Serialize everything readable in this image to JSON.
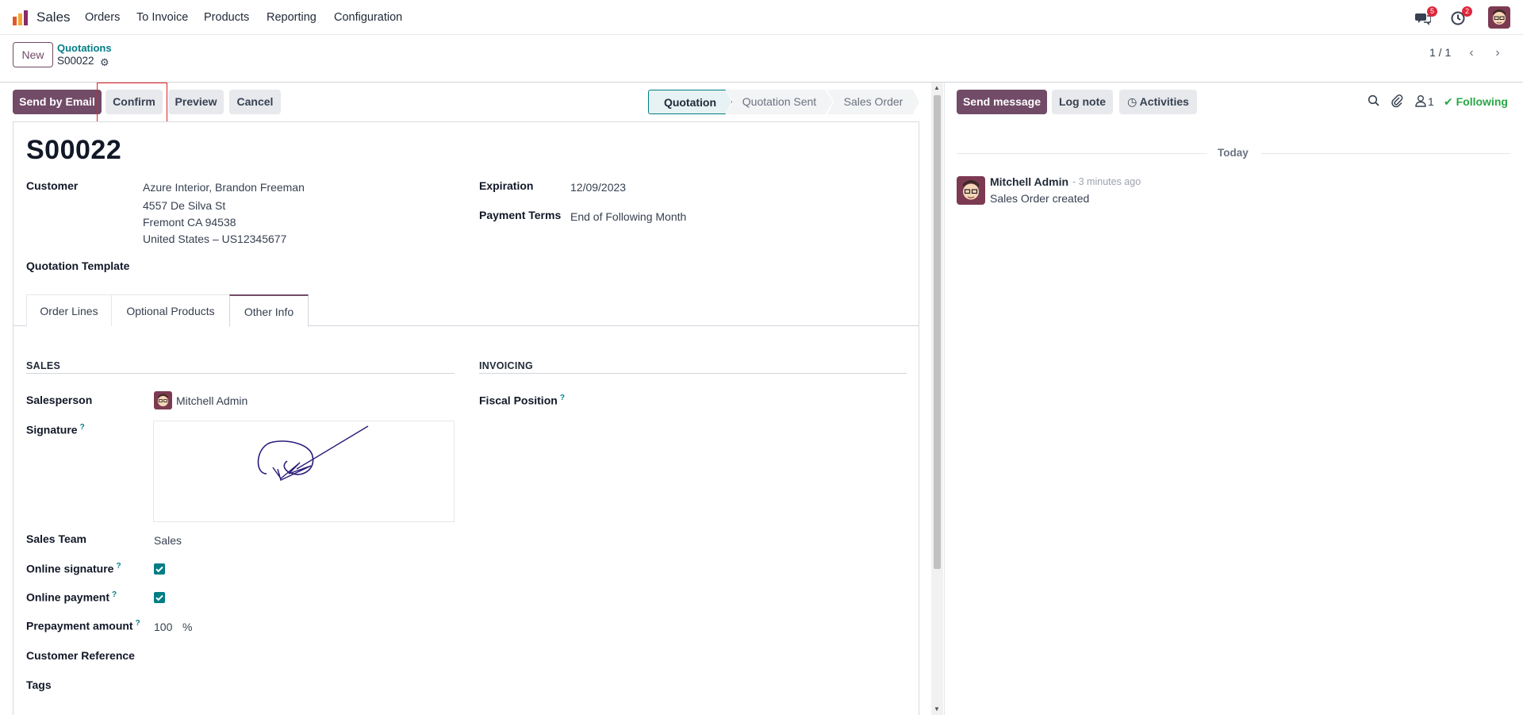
{
  "navbar": {
    "app_name": "Sales",
    "menu": [
      "Orders",
      "To Invoice",
      "Products",
      "Reporting",
      "Configuration"
    ],
    "messages_badge": "5",
    "activities_badge": "2"
  },
  "control_panel": {
    "new_label": "New",
    "breadcrumb_parent": "Quotations",
    "breadcrumb_current": "S00022",
    "pager": "1 / 1"
  },
  "actions": {
    "send_email": "Send by Email",
    "confirm": "Confirm",
    "preview": "Preview",
    "cancel": "Cancel"
  },
  "statusbar": {
    "states": [
      "Quotation",
      "Quotation Sent",
      "Sales Order"
    ],
    "active": "Quotation"
  },
  "form": {
    "title": "S00022",
    "customer_label": "Customer",
    "customer_lines": [
      "Azure Interior, Brandon Freeman",
      "4557 De Silva St",
      "Fremont CA 94538",
      "United States – US12345677"
    ],
    "expiration_label": "Expiration",
    "expiration_value": "12/09/2023",
    "payment_terms_label": "Payment Terms",
    "payment_terms_value": "End of Following Month",
    "quotation_template_label": "Quotation Template",
    "tabs": [
      "Order Lines",
      "Optional Products",
      "Other Info"
    ],
    "active_tab": "Other Info",
    "sales_section": "SALES",
    "invoicing_section": "INVOICING",
    "salesperson_label": "Salesperson",
    "salesperson_value": "Mitchell Admin",
    "signature_label": "Signature",
    "fiscal_position_label": "Fiscal Position",
    "sales_team_label": "Sales Team",
    "sales_team_value": "Sales",
    "online_signature_label": "Online signature",
    "online_signature_checked": true,
    "online_payment_label": "Online payment",
    "online_payment_checked": true,
    "prepayment_label": "Prepayment amount",
    "prepayment_value": "100",
    "prepayment_unit": "%",
    "customer_reference_label": "Customer Reference",
    "tags_label": "Tags",
    "help_mark": "?"
  },
  "chatter": {
    "send_message": "Send message",
    "log_note": "Log note",
    "activities": "Activities",
    "followers_count": "1",
    "following": "Following",
    "today": "Today",
    "message_author": "Mitchell Admin",
    "message_time": "- 3 minutes ago",
    "message_body": "Sales Order created"
  },
  "colors": {
    "primary": "#714b67",
    "teal": "#017e84",
    "following_green": "#28a745",
    "highlight_red": "#e02424"
  }
}
